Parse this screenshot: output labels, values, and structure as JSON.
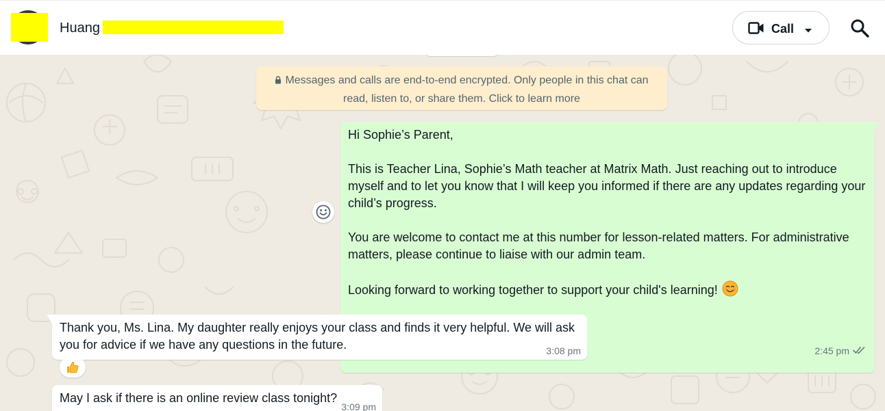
{
  "header": {
    "contact_name": "Huang",
    "call_label": "Call",
    "colors": {
      "redaction": "#ffff00",
      "header_bg": "#ffffff"
    }
  },
  "icons": {
    "video": "video-camera-icon",
    "caret": "chevron-down-icon",
    "search": "search-icon",
    "lock": "lock-icon",
    "emoji": "smiley-icon",
    "read": "double-check-icon",
    "thumbs": "thumbs-up-icon"
  },
  "chat": {
    "encryption_notice": "Messages and calls are end-to-end encrypted. Only people in this chat can read, listen to, or share them. Click to learn more",
    "messages": [
      {
        "direction": "outgoing",
        "text": "Hi Sophie’s Parent,\n\nThis is Teacher Lina, Sophie’s Math teacher at Matrix Math. Just reaching out to introduce myself and to let you know that I will keep you informed if there are any updates regarding your child’s progress.\n\nYou are welcome to contact me at this number for lesson-related matters. For administrative matters, please continue to liaise with our admin team.\n\nLooking forward to working together to support your child's learning!",
        "time": "2:45 pm",
        "status": "read"
      },
      {
        "direction": "incoming",
        "text": "Thank you, Ms. Lina. My daughter really enjoys your class and finds it very helpful. We will ask you for advice if we have any questions in the future.",
        "time": "3:08 pm",
        "reaction": "thumbs-up"
      },
      {
        "direction": "incoming",
        "text": "May I ask if there is an online review class tonight?",
        "time": "3:09 pm"
      }
    ],
    "colors": {
      "background": "#efeae2",
      "outgoing_bubble": "#d9fdd3",
      "incoming_bubble": "#ffffff",
      "notice_bubble": "#ffeecd",
      "meta_text": "#667781",
      "read_ticks": "#667781"
    }
  }
}
